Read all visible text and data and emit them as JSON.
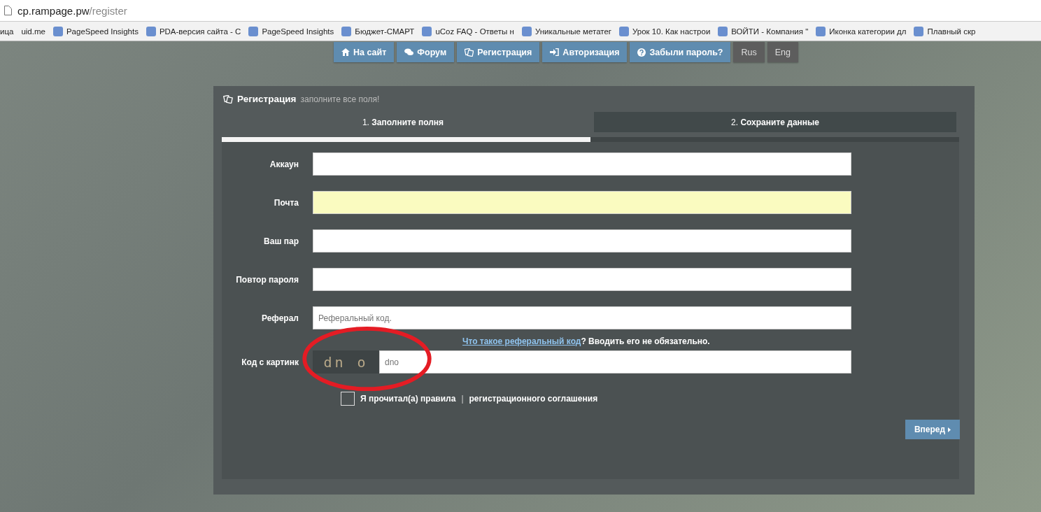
{
  "browser": {
    "url_host": "cp.rampage.pw",
    "url_path": "/register",
    "bookmarks": [
      {
        "label": "ица",
        "icon": false
      },
      {
        "label": "uid.me",
        "icon": false
      },
      {
        "label": "PageSpeed Insights",
        "icon": true
      },
      {
        "label": "PDA-версия сайта - С",
        "icon": true
      },
      {
        "label": "PageSpeed Insights",
        "icon": true
      },
      {
        "label": "Бюджет-СМАРТ",
        "icon": true
      },
      {
        "label": "uCoz FAQ - Ответы н",
        "icon": true
      },
      {
        "label": "Уникальные метатег",
        "icon": true
      },
      {
        "label": "Урок 10. Как настрои",
        "icon": true
      },
      {
        "label": "ВОЙТИ - Компания \"",
        "icon": true
      },
      {
        "label": "Иконка категории дл",
        "icon": true
      },
      {
        "label": "Плавный скр",
        "icon": true
      }
    ]
  },
  "nav": [
    {
      "kind": "home",
      "label": "На сайт"
    },
    {
      "kind": "forum",
      "label": "Форум"
    },
    {
      "kind": "register",
      "label": "Регистрация"
    },
    {
      "kind": "login",
      "label": "Авторизация"
    },
    {
      "kind": "help",
      "label": "Забыли пароль?"
    },
    {
      "kind": "lang",
      "label": "Rus"
    },
    {
      "kind": "lang",
      "label": "Eng"
    }
  ],
  "panel": {
    "title": "Регистрация",
    "subtitle": "заполните все поля!",
    "steps": [
      {
        "number": "1.",
        "label": "Заполните полня",
        "selected": true
      },
      {
        "number": "2.",
        "label": "Сохраните данные",
        "selected": false
      }
    ],
    "progress": {
      "level": 0.5
    },
    "fields": [
      {
        "label": "Аккаун",
        "autofilled": false
      },
      {
        "label": "Почта",
        "autofilled": true
      },
      {
        "label": "Ваш пар",
        "autofilled": false
      },
      {
        "label": "Повтор пароля",
        "autofilled": false
      },
      {
        "label": "Реферал",
        "placeholder": "Реферальный код.",
        "autofilled": false
      }
    ],
    "hint_link": "Что такое реферальный код",
    "hint_text": "? Вводить его не обязательно.",
    "captcha": {
      "label": "Код с картинк",
      "image_text": "dn o",
      "placeholder": "dno"
    },
    "agreement": {
      "checked": false,
      "text": "Я прочитал(а) правила",
      "separator": "|",
      "link": "регистрационного соглашения"
    },
    "next_button": "Вперед"
  }
}
